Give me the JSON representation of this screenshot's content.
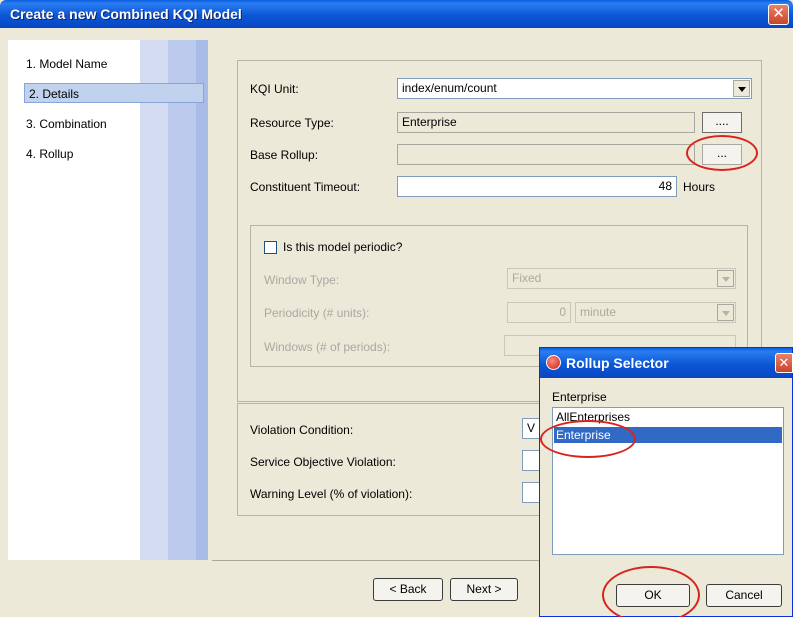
{
  "window": {
    "title": "Create a new Combined KQI Model",
    "close_glyph": "✕"
  },
  "nav": {
    "items": [
      {
        "label": "1. Model Name"
      },
      {
        "label": "2. Details",
        "selected": true
      },
      {
        "label": "3. Combination"
      },
      {
        "label": "4. Rollup"
      }
    ]
  },
  "details": {
    "kqi_unit": {
      "label": "KQI Unit:",
      "value": "index/enum/count"
    },
    "resource_type": {
      "label": "Resource Type:",
      "value": "Enterprise",
      "button": "...."
    },
    "base_rollup": {
      "label": "Base Rollup:",
      "value": "",
      "button": "..."
    },
    "constituent_timeout": {
      "label": "Constituent Timeout:",
      "value": "48",
      "unit": "Hours"
    }
  },
  "periodic": {
    "checkbox_label": "Is this model periodic?",
    "checked": false,
    "window_type": {
      "label": "Window Type:",
      "value": "Fixed"
    },
    "periodicity": {
      "label": "Periodicity (# units):",
      "value": "0",
      "unit": "minute"
    },
    "windows": {
      "label": "Windows (# of periods):",
      "value": ""
    }
  },
  "violation": {
    "condition": {
      "label": "Violation Condition:",
      "value": "V"
    },
    "service_objective": {
      "label": "Service Objective Violation:",
      "value": ""
    },
    "warning_level": {
      "label": "Warning Level (% of violation):",
      "value": ""
    }
  },
  "buttons": {
    "back": "< Back",
    "next": "Next >"
  },
  "rollup_selector": {
    "title": "Rollup Selector",
    "close_glyph": "✕",
    "current": "Enterprise",
    "options": [
      {
        "label": "AllEnterprises",
        "selected": false
      },
      {
        "label": "Enterprise",
        "selected": true
      }
    ],
    "ok": "OK",
    "cancel": "Cancel"
  },
  "colors": {
    "annotation": "#d9231e",
    "titlebar": "#0c56d6",
    "selection": "#316ac5"
  }
}
